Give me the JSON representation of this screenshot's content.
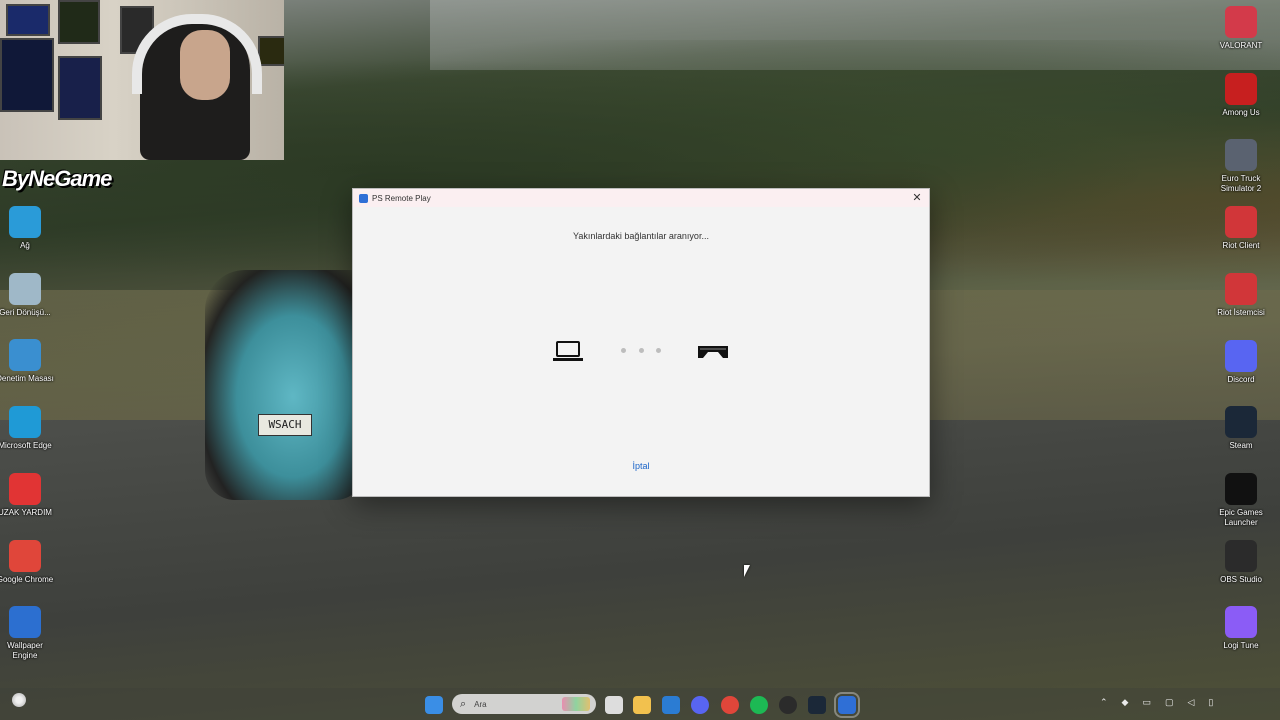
{
  "webcam_overlay": {
    "channel_logo": "ByNeGame"
  },
  "plate_text": "WSACH",
  "desktop_icons_left": [
    {
      "label": "Ağ",
      "icon": "network-icon",
      "color": "#2a9bd8"
    },
    {
      "label": "Geri Dönüşü...",
      "icon": "recycle-bin-icon",
      "color": "#9fb8c8"
    },
    {
      "label": "Denetim Masası",
      "icon": "control-panel-icon",
      "color": "#3a8fd0"
    },
    {
      "label": "Microsoft Edge",
      "icon": "edge-icon",
      "color": "#1f9ad6"
    },
    {
      "label": "UZAK YARDIM",
      "icon": "remote-help-icon",
      "color": "#e13434"
    },
    {
      "label": "Google Chrome",
      "icon": "chrome-icon",
      "color": "#e0463a"
    },
    {
      "label": "Wallpaper Engine",
      "icon": "wallpaper-engine-icon",
      "color": "#2c6fd0"
    }
  ],
  "desktop_icons_right": [
    {
      "label": "VALORANT",
      "icon": "valorant-icon",
      "color": "#d33a4a"
    },
    {
      "label": "Among Us",
      "icon": "among-us-icon",
      "color": "#c71f1f"
    },
    {
      "label": "Euro Truck Simulator 2",
      "icon": "euro-truck-icon",
      "color": "#5a6270"
    },
    {
      "label": "Riot Client",
      "icon": "riot-client-icon",
      "color": "#d13639"
    },
    {
      "label": "Riot İstemcisi",
      "icon": "riot-client-icon",
      "color": "#d13639"
    },
    {
      "label": "Discord",
      "icon": "discord-icon",
      "color": "#5865f2"
    },
    {
      "label": "Steam",
      "icon": "steam-icon",
      "color": "#1b2838"
    },
    {
      "label": "Epic Games Launcher",
      "icon": "epic-games-icon",
      "color": "#111111"
    },
    {
      "label": "OBS Studio",
      "icon": "obs-icon",
      "color": "#2b2b2b"
    },
    {
      "label": "Logi Tune",
      "icon": "logi-tune-icon",
      "color": "#8b5cf6"
    }
  ],
  "dialog": {
    "title": "PS Remote Play",
    "close_glyph": "✕",
    "status_text": "Yakınlardaki bağlantılar aranıyor...",
    "cancel_label": "İptal"
  },
  "taskbar": {
    "search_placeholder": "Ara",
    "apps": [
      {
        "name": "start-icon",
        "color": "#3a8ee6"
      },
      {
        "name": "task-view-icon",
        "color": "#dddddd"
      },
      {
        "name": "file-explorer-icon",
        "color": "#f2c14e"
      },
      {
        "name": "store-icon",
        "color": "#2b7cd3"
      },
      {
        "name": "discord-taskbar-icon",
        "color": "#5865f2"
      },
      {
        "name": "chrome-taskbar-icon",
        "color": "#e0463a"
      },
      {
        "name": "spotify-icon",
        "color": "#1db954"
      },
      {
        "name": "obs-taskbar-icon",
        "color": "#2b2b2b"
      },
      {
        "name": "steam-taskbar-icon",
        "color": "#1b2838"
      },
      {
        "name": "ps-remote-play-taskbar-icon",
        "color": "#2f6fd6"
      }
    ]
  },
  "accent_color": "#1a64c8"
}
